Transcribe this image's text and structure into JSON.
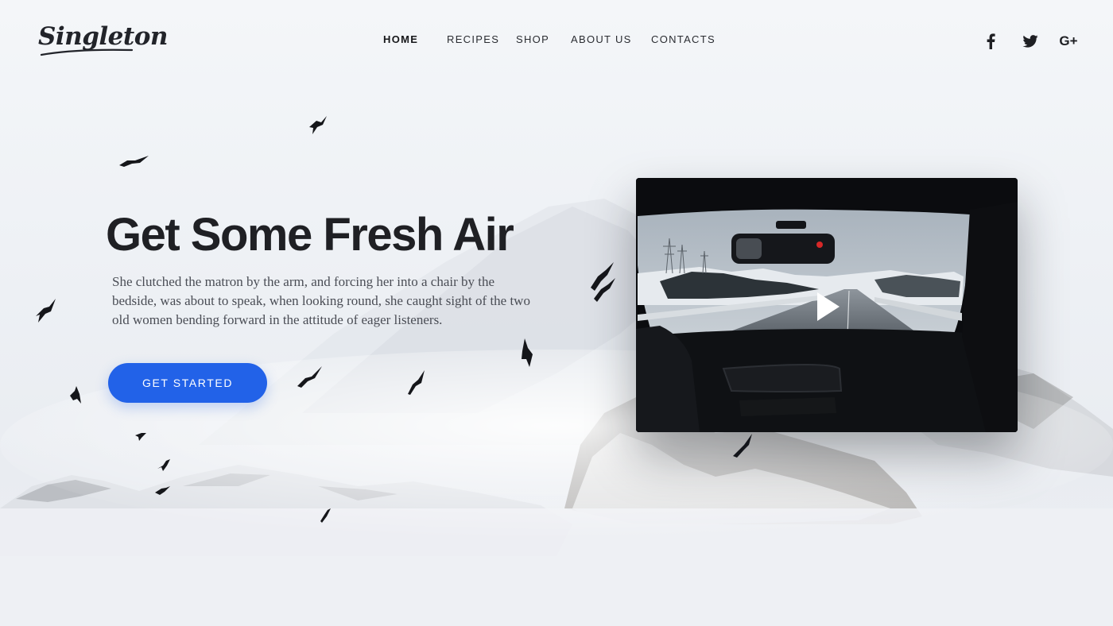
{
  "brand": {
    "logo_text": "Singleton"
  },
  "nav": {
    "items": [
      {
        "label": "HOME",
        "active": true
      },
      {
        "label": "RECIPES",
        "active": false
      },
      {
        "label": "SHOP",
        "active": false
      },
      {
        "label": "ABOUT US",
        "active": false
      },
      {
        "label": "CONTACTS",
        "active": false
      }
    ]
  },
  "social": {
    "facebook_label": "f",
    "google_plus_label": "G+",
    "icons": [
      "facebook-icon",
      "twitter-icon",
      "google-plus-icon"
    ]
  },
  "hero": {
    "title": "Get Some Fresh Air",
    "body": "She clutched the matron by the arm, and forcing her into a chair by the bedside, was about to speak, when looking round, she caught sight of the two old women bending forward in the attitude of eager listeners.",
    "cta_label": "GET STARTED"
  },
  "video": {
    "play_icon": "play-icon",
    "recording_indicator_color": "#d62828"
  },
  "colors": {
    "accent": "#2262e8",
    "text_dark": "#1f2024",
    "background": "#f0f2f6"
  }
}
